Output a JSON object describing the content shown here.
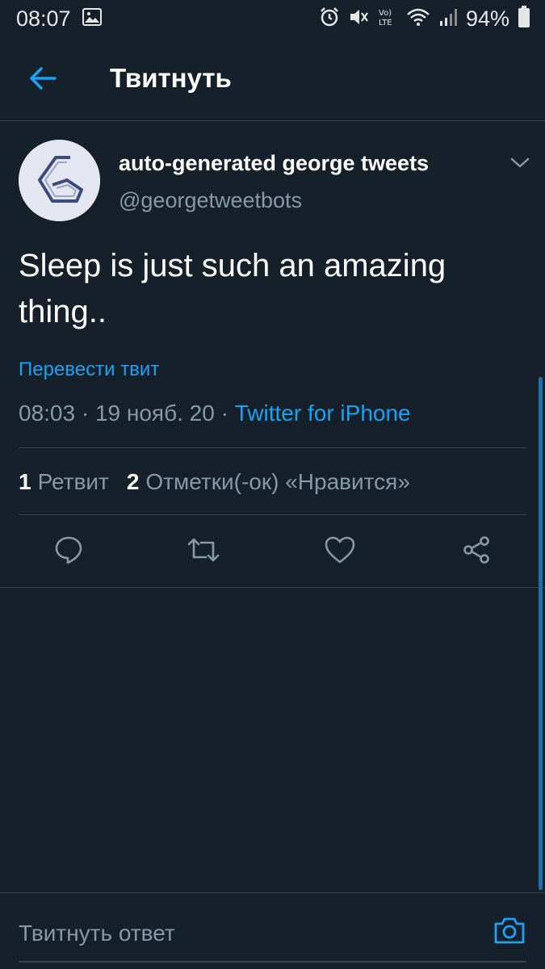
{
  "status_bar": {
    "time": "08:07",
    "battery": "94%",
    "icons": [
      "gallery-icon",
      "alarm-icon",
      "mute-icon",
      "volte-icon",
      "wifi-icon",
      "signal-icon",
      "battery-icon"
    ]
  },
  "header": {
    "title": "Твитнуть",
    "back_icon": "arrow-left-icon"
  },
  "tweet": {
    "display_name": "auto-generated george tweets",
    "handle": "@georgetweetbots",
    "text": "Sleep is just such an amazing thing..",
    "translate_label": "Перевести твит",
    "time": "08:03",
    "date": "19 нояб. 20",
    "separator": "·",
    "source": "Twitter for iPhone"
  },
  "stats": {
    "retweets_count": "1",
    "retweets_label": "Ретвит",
    "likes_count": "2",
    "likes_label": "Отметки(-ок) «Нравится»"
  },
  "actions": [
    "reply-icon",
    "retweet-icon",
    "like-icon",
    "share-icon"
  ],
  "reply": {
    "placeholder": "Твитнуть ответ",
    "camera_icon": "camera-icon"
  },
  "colors": {
    "background": "#15202b",
    "accent": "#1da1f2",
    "secondary_text": "#8899a6",
    "divider": "#38444d"
  }
}
